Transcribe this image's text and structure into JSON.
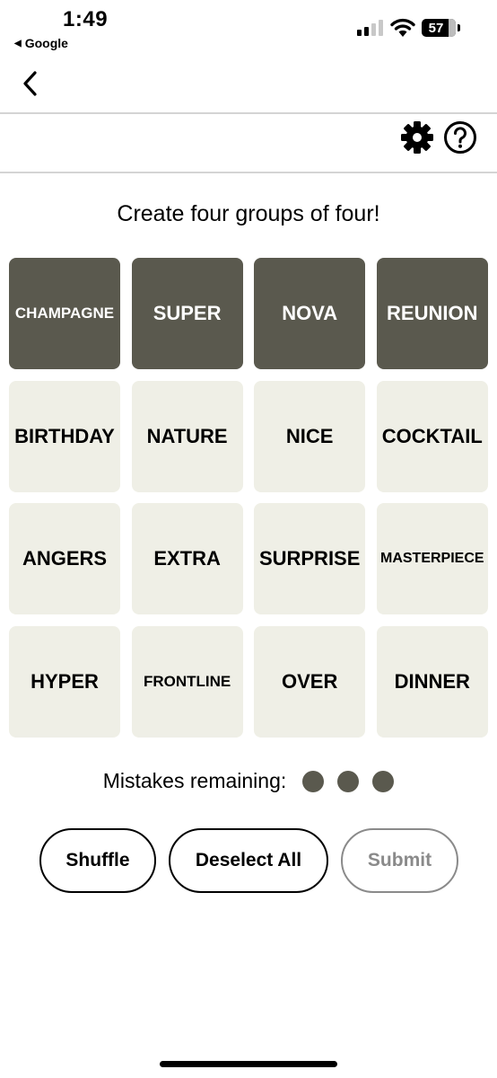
{
  "status_bar": {
    "time": "1:49",
    "back_app": "Google",
    "battery_level": "57",
    "signal_bars_active": 2,
    "signal_bars_total": 4
  },
  "header": {
    "back_icon": "chevron-left-icon",
    "settings_icon": "gear-icon",
    "help_icon": "question-circle-icon"
  },
  "game": {
    "instructions": "Create four groups of four!",
    "tiles": [
      {
        "word": "CHAMPAGNE",
        "selected": true
      },
      {
        "word": "SUPER",
        "selected": true
      },
      {
        "word": "NOVA",
        "selected": true
      },
      {
        "word": "REUNION",
        "selected": true
      },
      {
        "word": "BIRTHDAY",
        "selected": false
      },
      {
        "word": "NATURE",
        "selected": false
      },
      {
        "word": "NICE",
        "selected": false
      },
      {
        "word": "COCKTAIL",
        "selected": false
      },
      {
        "word": "ANGERS",
        "selected": false
      },
      {
        "word": "EXTRA",
        "selected": false
      },
      {
        "word": "SURPRISE",
        "selected": false
      },
      {
        "word": "MASTERPIECE",
        "selected": false
      },
      {
        "word": "HYPER",
        "selected": false
      },
      {
        "word": "FRONTLINE",
        "selected": false
      },
      {
        "word": "OVER",
        "selected": false
      },
      {
        "word": "DINNER",
        "selected": false
      }
    ],
    "mistakes_label": "Mistakes remaining:",
    "mistakes_remaining": 3
  },
  "actions": {
    "shuffle_label": "Shuffle",
    "deselect_label": "Deselect All",
    "submit_label": "Submit",
    "submit_enabled": false
  },
  "colors": {
    "selected_tile": "#5a594e",
    "tile": "#efefe6",
    "dot": "#5a594e"
  }
}
